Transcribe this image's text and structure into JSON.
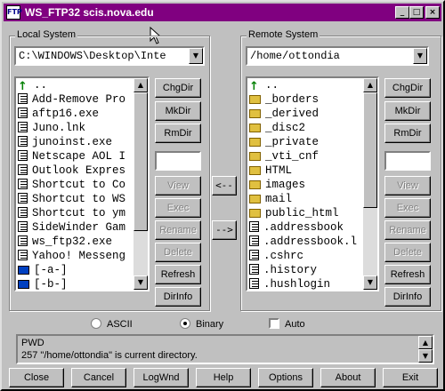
{
  "window": {
    "title": "WS_FTP32 scis.nova.edu",
    "app_icon_text": "FTP"
  },
  "local": {
    "group_label": "Local System",
    "path": "C:\\WINDOWS\\Desktop\\Inte",
    "files": [
      {
        "name": "..",
        "icon": "up-arrow-icon"
      },
      {
        "name": "Add-Remove Pro",
        "icon": "file-icon"
      },
      {
        "name": "aftp16.exe",
        "icon": "file-icon"
      },
      {
        "name": "Juno.lnk",
        "icon": "file-icon"
      },
      {
        "name": "junoinst.exe",
        "icon": "file-icon"
      },
      {
        "name": "Netscape AOL I",
        "icon": "file-icon"
      },
      {
        "name": "Outlook Expres",
        "icon": "file-icon"
      },
      {
        "name": "Shortcut to Co",
        "icon": "file-icon"
      },
      {
        "name": "Shortcut to WS",
        "icon": "file-icon"
      },
      {
        "name": "Shortcut to ym",
        "icon": "file-icon"
      },
      {
        "name": "SideWinder Gam",
        "icon": "file-icon"
      },
      {
        "name": "ws_ftp32.exe",
        "icon": "file-icon"
      },
      {
        "name": "Yahoo! Messeng",
        "icon": "file-icon"
      },
      {
        "name": "[-a-]",
        "icon": "drive-icon"
      },
      {
        "name": "[-b-]",
        "icon": "drive-icon"
      }
    ],
    "buttons": [
      "ChgDir",
      "MkDir",
      "RmDir",
      "View",
      "Exec",
      "Rename",
      "Delete",
      "Refresh",
      "DirInfo"
    ]
  },
  "remote": {
    "group_label": "Remote System",
    "path": "/home/ottondia",
    "files": [
      {
        "name": "..",
        "icon": "up-arrow-icon"
      },
      {
        "name": "_borders",
        "icon": "folder-icon"
      },
      {
        "name": "_derived",
        "icon": "folder-icon"
      },
      {
        "name": "_disc2",
        "icon": "folder-icon"
      },
      {
        "name": "_private",
        "icon": "folder-icon"
      },
      {
        "name": "_vti_cnf",
        "icon": "folder-icon"
      },
      {
        "name": "HTML",
        "icon": "folder-icon"
      },
      {
        "name": "images",
        "icon": "folder-icon"
      },
      {
        "name": "mail",
        "icon": "folder-icon"
      },
      {
        "name": "public_html",
        "icon": "folder-icon"
      },
      {
        "name": ".addressbook",
        "icon": "file-icon"
      },
      {
        "name": ".addressbook.l",
        "icon": "file-icon"
      },
      {
        "name": ".cshrc",
        "icon": "file-icon"
      },
      {
        "name": ".history",
        "icon": "file-icon"
      },
      {
        "name": ".hushlogin",
        "icon": "file-icon"
      }
    ],
    "buttons": [
      "ChgDir",
      "MkDir",
      "RmDir",
      "View",
      "Exec",
      "Rename",
      "Delete",
      "Refresh",
      "DirInfo"
    ]
  },
  "transfer": {
    "to_local": "<--",
    "to_remote": "-->"
  },
  "mode": {
    "ascii": "ASCII",
    "binary": "Binary",
    "auto": "Auto",
    "selected": "Binary"
  },
  "status": {
    "line1": "PWD",
    "line2": "257 \"/home/ottondia\" is current directory."
  },
  "bottom_buttons": [
    "Close",
    "Cancel",
    "LogWnd",
    "Help",
    "Options",
    "About",
    "Exit"
  ],
  "colors": {
    "titlebar": "#800080",
    "face": "#c0c0c0"
  }
}
